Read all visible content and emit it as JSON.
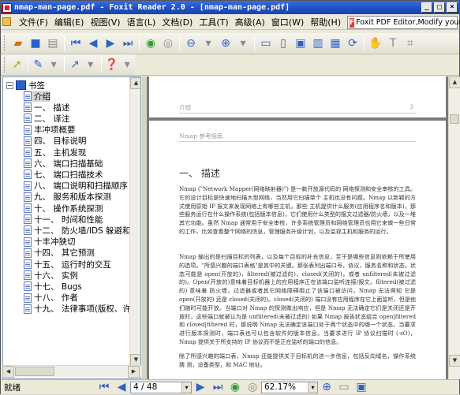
{
  "window": {
    "title": "nmap-man-page.pdf - Foxit Reader 2.0 - [nmap-man-page.pdf]"
  },
  "menu": [
    {
      "label": "文件(F)"
    },
    {
      "label": "编辑(E)"
    },
    {
      "label": "视图(V)"
    },
    {
      "label": "语言(L)"
    },
    {
      "label": "文档(D)"
    },
    {
      "label": "工具(T)"
    },
    {
      "label": "高级(A)"
    },
    {
      "label": "窗口(W)"
    },
    {
      "label": "帮助(H)"
    }
  ],
  "ad_banner": {
    "label": "Foxit PDF Editor,Modify your PDF!"
  },
  "bookmarks": {
    "root": "书签",
    "items": [
      "介绍",
      "一、 描述",
      "二、 译注",
      "丰冲项概要",
      "四、 目标说明",
      "五、 主机发现",
      "六、 端口扫描基础",
      "七、 端口扫描技术",
      "八、 端口说明和扫描顺序",
      "九、 服务和版本探测",
      "十、 操作系统探测",
      "十一、 时间和性能",
      "十二、 防火墙/IDS 躲避和哄骗",
      "十丰冲狭切",
      "十四、 其它预测",
      "十五、 运行时的交互",
      "十六、 实例",
      "十七、 Bugs",
      "十八、 作者",
      "十九、 法律事项(版权、许可证"
    ]
  },
  "document": {
    "prev_page_header": "介绍",
    "prev_page_number": "3",
    "page_header": "Nmap 参考指南",
    "heading": "一、 描述",
    "paragraphs": [
      "Nmap (\"Network Mapper(网络映射器)\") 是一款开放源代码的 网络探测和安全审核的工具。它的设计目标是快速地扫描大型网络，当然用它扫描单个 主机也没有问题。Nmap 以新颖的方式使用原始 IP 报文来发现网络上有哪些主机，那些 主机提供什么服务(应用程序名和版本)，那 些服务运行在什么操作系统(包括版本信息)，它们使用什么类型的报文过滤器/防火墙，以及一堆其它功能。虽然 Nmap 通常用于安全审核，许多系统管理员和网络管理员也用它来做一些日常的工作，比如查看整个网络的信息，管理服务升级计划，以及监视主机和服务的运行。",
      "Nmap 输出的是扫描目标的列表，以及每个目标的补充信息，至于是哪些信息则依赖于所使用的选项。\"所感兴趣的端口表格\"是其中的关键。那张表列出端口号，协议，服务名称和状态。状态可能是 open(开放的)，filtered(被过滤的)，closed(关闭的)，或者 unfiltered(未被过滤的)。Open(开放的)意味着目标机器上的应用程序正在该端口监听连接/报文。filtered(被过滤的) 意味着 防火墙，过滤器或者其它网络障碍阻止了该端口被访问，Nmap 无法得知 它是 open(开放的) 还是 closed(关闭的)。closed(关闭的) 端口没有应用程序在它上面监听，但是他们随时可能开放。当端口对 Nmap 的探测做出响应，但是 Nmap 无法确定它们是关闭还是开 放时，这些端口就被认为是 unfiltered(未被过滤的) 如果 Nmap 报告状态组合 open|filtered 和 closed|filtered 时，那说明 Nmap 无法确定该端口处于两个状态中的哪一个状态。当要求进行版本探测时，端口表也可以包含软件的版本信息。当要求进行 IP 协议扫描时 (-sO)，Nmap 提供关于所支持的 IP 协议而不是正在监听的端口的信息。",
      "除了所感兴趣的端口表，Nmap 还能提供关于目标机的进一步信息，包括反向域名，操作系统猜 测，设备类型，和 MAC 地址。"
    ]
  },
  "status": {
    "text": "就绪",
    "page_current": "4 / 48",
    "zoom": "62.17%"
  }
}
